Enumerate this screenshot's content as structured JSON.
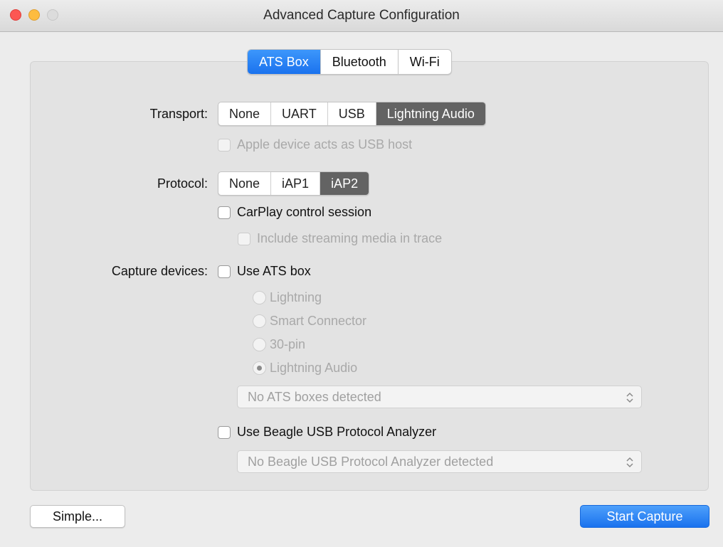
{
  "window": {
    "title": "Advanced Capture Configuration"
  },
  "tabs": [
    {
      "label": "ATS Box",
      "active": true
    },
    {
      "label": "Bluetooth",
      "active": false
    },
    {
      "label": "Wi-Fi",
      "active": false
    }
  ],
  "transport": {
    "label": "Transport:",
    "options": [
      "None",
      "UART",
      "USB",
      "Lightning Audio"
    ],
    "selected": "Lightning Audio",
    "usb_host_checkbox": {
      "label": "Apple device acts as USB host",
      "checked": false,
      "enabled": false
    }
  },
  "protocol": {
    "label": "Protocol:",
    "options": [
      "None",
      "iAP1",
      "iAP2"
    ],
    "selected": "iAP2",
    "carplay_checkbox": {
      "label": "CarPlay control session",
      "checked": false,
      "enabled": true
    },
    "streaming_checkbox": {
      "label": "Include streaming media in trace",
      "checked": false,
      "enabled": false
    }
  },
  "capture_devices": {
    "label": "Capture devices:",
    "use_ats_box": {
      "label": "Use ATS box",
      "checked": false,
      "enabled": true
    },
    "connector_options": [
      {
        "label": "Lightning",
        "selected": false
      },
      {
        "label": "Smart Connector",
        "selected": false
      },
      {
        "label": "30-pin",
        "selected": false
      },
      {
        "label": "Lightning Audio",
        "selected": true
      }
    ],
    "ats_box_select": {
      "value": "No ATS boxes detected",
      "enabled": false
    },
    "use_beagle": {
      "label": "Use Beagle USB Protocol Analyzer",
      "checked": false,
      "enabled": true
    },
    "beagle_select": {
      "value": "No Beagle USB Protocol Analyzer detected",
      "enabled": false
    }
  },
  "buttons": {
    "simple": "Simple...",
    "start_capture": "Start Capture"
  },
  "colors": {
    "accent": "#1a72ee",
    "segment_selected": "#636363",
    "window_bg": "#ececec",
    "box_bg": "#e3e3e3"
  }
}
